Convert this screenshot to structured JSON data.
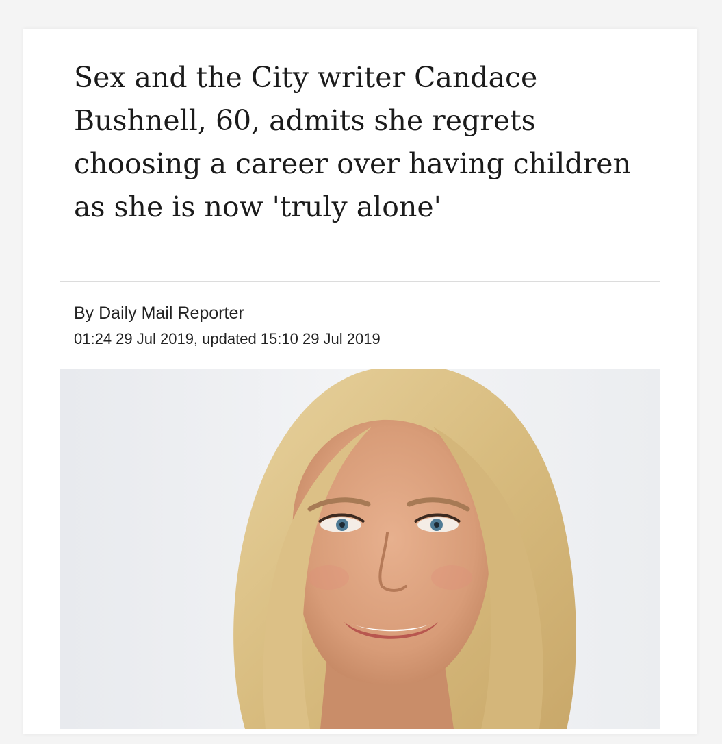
{
  "article": {
    "headline": "Sex and the City writer Candace Bushnell, 60, admits she regrets choosing a career over having children as she is now 'truly alone'",
    "byline": "By Daily Mail Reporter",
    "timestamp": "01:24 29 Jul 2019, updated 15:10 29 Jul 2019"
  },
  "colors": {
    "background": "#f4f4f4",
    "card": "#ffffff",
    "headline_text": "#1b1b1b",
    "divider": "#dcdcdc"
  }
}
